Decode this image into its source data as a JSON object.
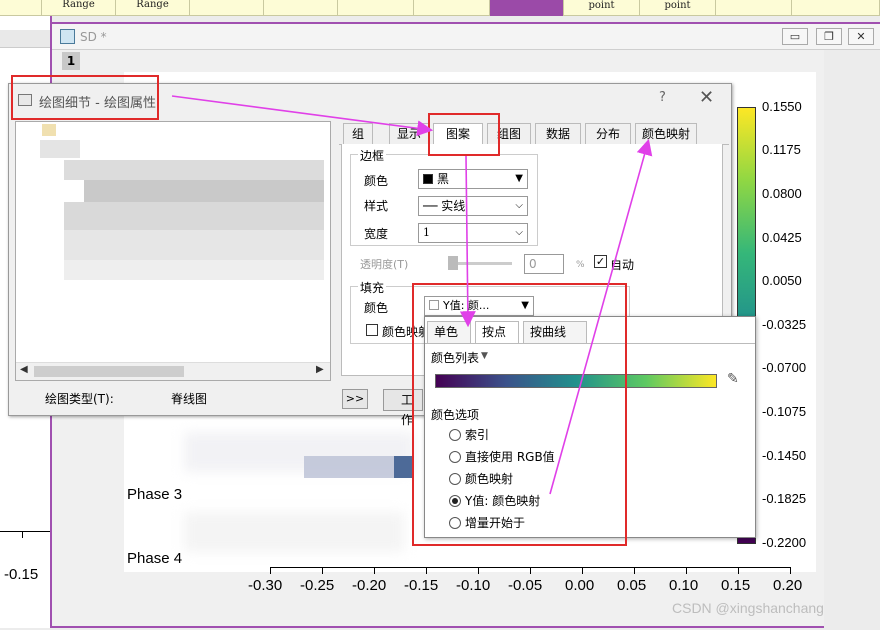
{
  "sheet_strip": {
    "cells": [
      "Range",
      "Range",
      "point",
      "point"
    ]
  },
  "sd_window": {
    "title": "SD *",
    "tab": "1",
    "buttons": {
      "minimize": "▭",
      "restore": "❐",
      "close": "✕"
    }
  },
  "plot": {
    "left_window_tick": "-0.15",
    "phase_labels": [
      "Phase 3",
      "Phase 4"
    ],
    "x_ticks": [
      "-0.30",
      "-0.25",
      "-0.20",
      "-0.15",
      "-0.10",
      "-0.05",
      "0.00",
      "0.05",
      "0.10",
      "0.15",
      "0.20"
    ],
    "colorbar_ticks": [
      "0.1550",
      "0.1175",
      "0.0800",
      "0.0425",
      "0.0050",
      "-0.0325",
      "-0.0700",
      "-0.1075",
      "-0.1450",
      "-0.1825",
      "-0.2200"
    ]
  },
  "dialog": {
    "title": "绘图细节 - 绘图属性",
    "help": "?",
    "close": "✕",
    "plot_type_label": "绘图类型(T):",
    "plot_type_value": "脊线图",
    "expand_button": ">>",
    "work_button": "工作",
    "tabs": [
      "组",
      "显示",
      "图案",
      "组图",
      "数据",
      "分布",
      "颜色映射"
    ],
    "active_tab": "图案",
    "border": {
      "group_label": "边框",
      "color_label": "颜色",
      "color_value": "黑",
      "style_label": "样式",
      "style_value": "实线",
      "width_label": "宽度",
      "width_value": "1"
    },
    "transparency_label": "透明度(T)",
    "transparency_value": "0",
    "transparency_unit": "%",
    "auto_label": "自动",
    "fill": {
      "group_label": "填充",
      "color_label": "颜色",
      "color_value": "Y值: 颜...",
      "colormap_label": "颜色映射"
    }
  },
  "popup": {
    "tabs": [
      "单色",
      "按点",
      "按曲线"
    ],
    "active_tab": "按点",
    "color_list_label": "颜色列表",
    "color_options_label": "颜色选项",
    "options": [
      "索引",
      "直接使用 RGB值",
      "颜色映射",
      "Y值: 颜色映射",
      "增量开始于"
    ],
    "selected_option": "Y值: 颜色映射"
  },
  "watermark": "CSDN @xingshanchang",
  "colors": {
    "annotation_red": "#e02a2a",
    "arrow_magenta": "#e040e8",
    "window_border": "#a050b0"
  }
}
